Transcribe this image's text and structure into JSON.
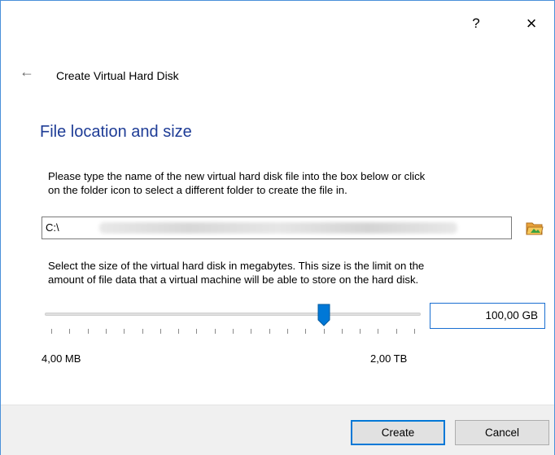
{
  "window": {
    "help_label": "?",
    "close_label": "×"
  },
  "wizard": {
    "back_label": "←",
    "title": "Create Virtual Hard Disk"
  },
  "section": {
    "title": "File location and size"
  },
  "location": {
    "description_line1": "Please type the name of the new virtual hard disk file into the box below or click",
    "description_line2": "on the folder icon to select a different folder to create the file in.",
    "path_value": "C:\\"
  },
  "size": {
    "description_line1": "Select the size of the virtual hard disk in megabytes. This size is the limit on the",
    "description_line2": "amount of file data that a virtual machine will be able to store on the hard disk.",
    "value": "100,00 GB",
    "slider_min_label": "4,00 MB",
    "slider_max_label": "2,00 TB",
    "slider_position": 0.75
  },
  "buttons": {
    "create_label": "Create",
    "cancel_label": "Cancel"
  },
  "colors": {
    "accent": "#0078d7",
    "section_title": "#1e3c96"
  }
}
